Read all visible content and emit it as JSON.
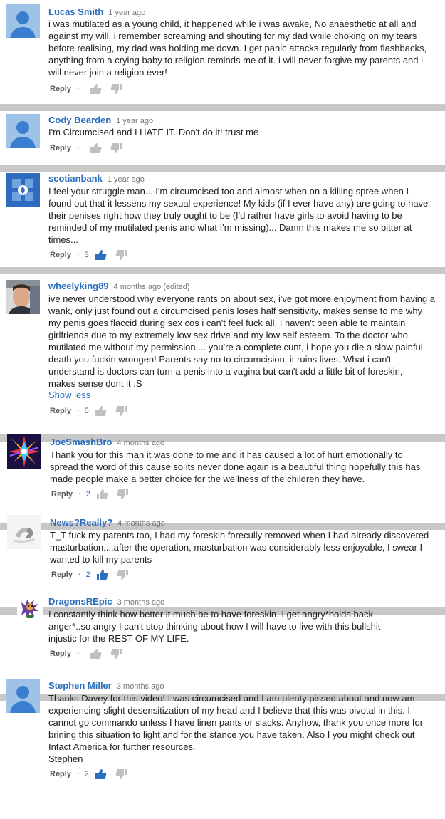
{
  "comments": [
    {
      "author": "Lucas Smith",
      "time": "1 year ago",
      "text": "i was mutilated as a young child, it happened while i was awake, No anaesthetic at all and\nagainst my will, i remember screaming and shouting for my dad while choking on my tears\nbefore realising, my dad was holding me down. I get panic attacks regularly from flashbacks,\nanything from a crying baby to religion reminds me of it. i will never forgive my parents and i\nwill never join a religion ever!",
      "reply": "Reply",
      "likes": "",
      "liked": false,
      "avatar": "default-avatar"
    },
    {
      "author": "Cody Bearden",
      "time": "1 year ago",
      "text": "I'm Circumcised and I HATE IT. Don't do it! trust me",
      "reply": "Reply",
      "likes": "",
      "liked": false,
      "avatar": "default-avatar"
    },
    {
      "author": "scotianbank",
      "time": "1 year ago",
      "text": "I feel your struggle man... I'm circumcised too and almost when on a killing spree when I\nfound out that it lessens my sexual experience! My kids (if I ever have any) are going to have\ntheir penises right how they truly ought to be (I'd rather have girls to avoid having to be\nreminded of my mutilated penis and what I'm missing)... Damn this makes me so bitter at\ntimes...",
      "reply": "Reply",
      "likes": "3",
      "liked": true,
      "avatar": "scotianbank-avatar"
    },
    {
      "author": "wheelyking89",
      "time": "4 months ago (edited)",
      "text": "ive never understood why everyone rants on about sex, i've got more enjoyment from having a\nwank, only just found out a circumcised penis loses half sensitivity, makes sense to me why\nmy penis goes flaccid during sex cos i can't feel fuck all. I haven't been able to maintain\ngirlfriends due to my extremely low sex drive and my low self esteem. To the doctor who\nmutilated me without my permission.... you're a complete cunt, i hope you die a slow painful\ndeath you fuckin wrongen! Parents say no to circumcision, it ruins lives. What i can't\nunderstand is doctors can turn a penis into a vagina but can't add a little bit of foreskin,\nmakes sense dont it :S",
      "show_less": "Show less",
      "reply": "Reply",
      "likes": "5",
      "liked": false,
      "avatar": "photo-avatar"
    },
    {
      "author": "JoeSmashBro",
      "time": "4 months ago",
      "text": "Thank you for this man it was done to me and it has caused a lot of hurt emotionally to\nspread the word of this cause so its never done again is a beautiful thing hopefully this has\nmade people make a better choice for the wellness of the children they have.",
      "reply": "Reply",
      "likes": "2",
      "liked": false,
      "avatar": "abstract-avatar"
    },
    {
      "author": "News?Really?",
      "time": "4 months ago",
      "text": "T_T fuck my parents too, I had my foreskin forecully removed when I had already discovered\nmasturbation....after the operation, masturbation was considerably less enjoyable, I swear I\nwanted to kill my parents",
      "reply": "Reply",
      "likes": "2",
      "liked": true,
      "avatar": "logo-avatar"
    },
    {
      "author": "DragonsREpic",
      "time": "3 months ago",
      "text": "I constantly think how better it much be to have foreskin. I get angry*holds back\nanger*..so angry I can't stop thinking about how I will have to live with this bullshit\ninjustic for the REST OF MY LIFE.",
      "reply": "Reply",
      "likes": "",
      "liked": false,
      "avatar": "dragon-avatar"
    },
    {
      "author": "Stephen Miller",
      "time": "3 months ago",
      "text": "Thanks Davey for this video! I was circumcised and I am plenty pissed about and now am\nexperiencing slight desensitization of my head and I believe that  this was pivotal in this. I\ncannot go commando unless I have linen pants or slacks. Anyhow, thank you once more for\nbrining this situation to light and for the stance you have taken. Also I you might check out\nIntact America for further resources.\nStephen",
      "reply": "Reply",
      "likes": "2",
      "liked": true,
      "avatar": "default-avatar"
    }
  ],
  "colors": {
    "author": "#2b6ebd",
    "separator": "#c8c8c8",
    "thumb_inactive": "#c0c0c0",
    "thumb_active": "#2b6ebd"
  }
}
